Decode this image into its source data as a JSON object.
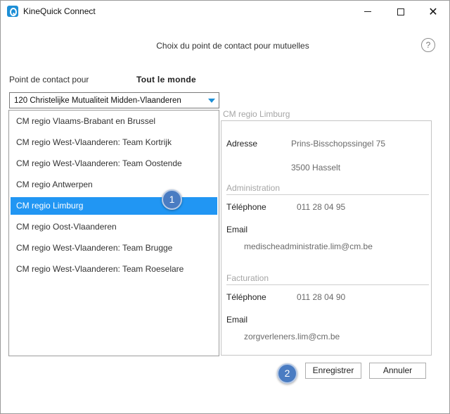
{
  "window": {
    "title": "KineQuick Connect",
    "minimize": "",
    "maximize": "",
    "close": "✕"
  },
  "header": {
    "title": "Choix du point de contact pour mutuelles",
    "help": "?"
  },
  "contact_for": {
    "label": "Point de contact pour",
    "value": "Tout le monde"
  },
  "mutuality_select": {
    "value": "120 Christelijke Mutualiteit Midden-Vlaanderen"
  },
  "contact_points": [
    {
      "label": "CM regio Vlaams-Brabant en Brussel",
      "selected": false
    },
    {
      "label": "CM regio West-Vlaanderen: Team Kortrijk",
      "selected": false
    },
    {
      "label": "CM regio West-Vlaanderen: Team Oostende",
      "selected": false
    },
    {
      "label": "CM regio Antwerpen",
      "selected": false
    },
    {
      "label": "CM regio Limburg",
      "selected": true
    },
    {
      "label": "CM regio Oost-Vlaanderen",
      "selected": false
    },
    {
      "label": "CM regio West-Vlaanderen: Team Brugge",
      "selected": false
    },
    {
      "label": "CM regio West-Vlaanderen: Team Roeselare",
      "selected": false
    }
  ],
  "detail": {
    "heading": "CM regio Limburg",
    "address_label": "Adresse",
    "address_line1": "Prins-Bisschopssingel 75",
    "address_line2": "3500 Hasselt",
    "administration": {
      "section": "Administration",
      "phone_label": "Téléphone",
      "phone": "011 28 04 95",
      "email_label": "Email",
      "email": "medischeadministratie.lim@cm.be"
    },
    "billing": {
      "section": "Facturation",
      "phone_label": "Téléphone",
      "phone": "011 28 04 90",
      "email_label": "Email",
      "email": "zorgverleners.lim@cm.be"
    }
  },
  "buttons": {
    "save": "Enregistrer",
    "cancel": "Annuler"
  },
  "markers": [
    "1",
    "2"
  ],
  "colors": {
    "selection": "#2196f3",
    "marker": "#4a7cc2",
    "app_icon": "#1e8fd6"
  }
}
